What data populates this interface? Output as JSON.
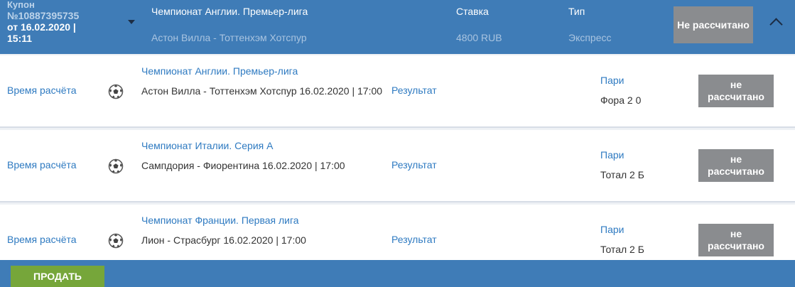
{
  "header": {
    "coupon_label": "Купон",
    "coupon_number": "№10887395735",
    "coupon_date": "от 16.02.2020 |",
    "coupon_time": "15:11",
    "league": "Чемпионат Англии. Премьер-лига",
    "match": "Астон Вилла - Тоттенхэм Хотспур",
    "stake_label": "Ставка",
    "stake_value": "4800 RUB",
    "type_label": "Тип",
    "type_value": "Экспресс",
    "status": "Не рассчитано"
  },
  "rows": [
    {
      "calc_time": "Время расчёта",
      "icon": "soccer-ball-icon",
      "league": "Чемпионат Англии. Премьер-лига",
      "match": "Астон Вилла - Тоттенхэм Хотспур 16.02.2020 | 17:00",
      "result": "Результат",
      "bet_label": "Пари",
      "bet_value": "Фора 2 0",
      "status": "не рассчитано"
    },
    {
      "calc_time": "Время расчёта",
      "icon": "soccer-ball-icon",
      "league": "Чемпионат Италии. Серия А",
      "match": "Сампдория - Фиорентина 16.02.2020 | 17:00",
      "result": "Результат",
      "bet_label": "Пари",
      "bet_value": "Тотал 2 Б",
      "status": "не рассчитано"
    },
    {
      "calc_time": "Время расчёта",
      "icon": "soccer-ball-icon",
      "league": "Чемпионат Франции. Первая лига",
      "match": "Лион - Страсбург 16.02.2020 | 17:00",
      "result": "Результат",
      "bet_label": "Пари",
      "bet_value": "Тотал 2 Б",
      "status": "не рассчитано"
    }
  ],
  "footer": {
    "sell_label": "ПРОДАТЬ"
  },
  "colors": {
    "header_bg": "#3f7cb7",
    "link": "#2e7ac1",
    "status_bg": "#8a8c8f",
    "sell_button": "#76a63a"
  }
}
